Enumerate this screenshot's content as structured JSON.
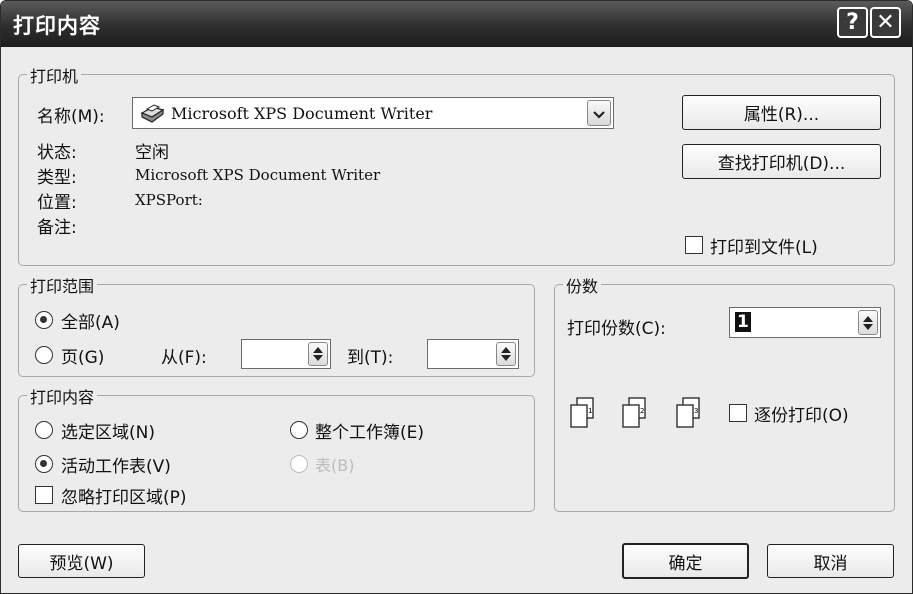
{
  "window": {
    "title": "打印内容"
  },
  "titlebar": {
    "help_glyph": "?",
    "close_glyph": "✕"
  },
  "printer": {
    "legend": "打印机",
    "name_label": "名称(M):",
    "name_value": "Microsoft XPS Document Writer",
    "status_label": "状态:",
    "status_value": "空闲",
    "type_label": "类型:",
    "type_value": "Microsoft XPS Document Writer",
    "where_label": "位置:",
    "where_value": "XPSPort:",
    "comment_label": "备注:",
    "properties_button": "属性(R)...",
    "find_printer_button": "查找打印机(D)...",
    "print_to_file_label": "打印到文件(L)",
    "print_to_file_checked": false
  },
  "range": {
    "legend": "打印范围",
    "all_label": "全部(A)",
    "pages_label": "页(G)",
    "from_label": "从(F):",
    "to_label": "到(T):",
    "from_value": "",
    "to_value": "",
    "selected": "all"
  },
  "copies": {
    "legend": "份数",
    "count_label": "打印份数(C):",
    "count_value": "1",
    "collate_label": "逐份打印(O)",
    "collate_checked": false,
    "page_icons": [
      "1",
      "2",
      "3"
    ]
  },
  "what": {
    "legend": "打印内容",
    "selection_label": "选定区域(N)",
    "workbook_label": "整个工作簿(E)",
    "active_sheets_label": "活动工作表(V)",
    "table_label": "表(B)",
    "ignore_print_area_label": "忽略打印区域(P)",
    "selected": "active_sheets"
  },
  "footer": {
    "preview_button": "预览(W)",
    "ok_button": "确定",
    "cancel_button": "取消"
  },
  "icons": [
    "help-icon",
    "close-icon",
    "printer-icon",
    "chevron-down-icon",
    "spin-up-icon",
    "spin-down-icon",
    "collate-page-icon"
  ]
}
